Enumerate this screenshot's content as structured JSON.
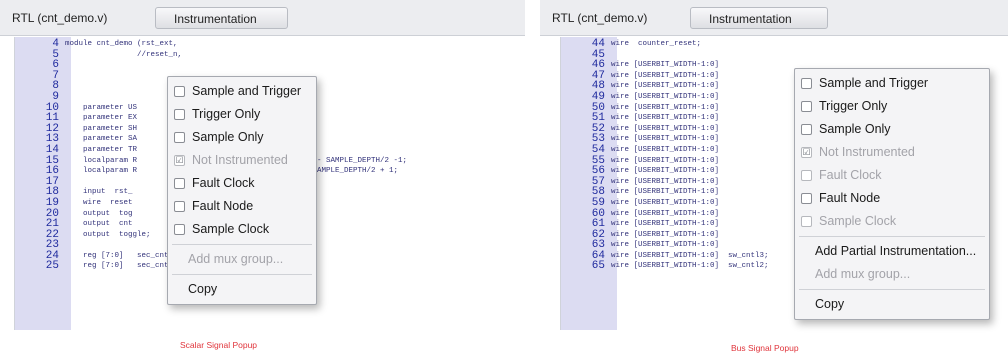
{
  "panels": {
    "scalar": {
      "file_tab": "RTL (cnt_demo.v)",
      "instr_tab": "Instrumentation",
      "lines": [
        {
          "num": "4",
          "code": "module cnt_demo (rst_ext,"
        },
        {
          "num": "5",
          "code": "                //reset_n,"
        },
        {
          "num": "6",
          "code": "                "
        },
        {
          "num": "7",
          "code": "                "
        },
        {
          "num": "8",
          "code": "                "
        },
        {
          "num": "9",
          "code": "                "
        },
        {
          "num": "10",
          "code": "    parameter US"
        },
        {
          "num": "11",
          "code": "    parameter EX"
        },
        {
          "num": "12",
          "code": "    parameter SH"
        },
        {
          "num": "13",
          "code": "    parameter SA"
        },
        {
          "num": "14",
          "code": "    parameter TR"
        },
        {
          "num": "15",
          "code": "    localparam R                              _POSITION - SAMPLE_DEPTH/2 -1;"
        },
        {
          "num": "16",
          "code": "    localparam R                             OSITION - SAMPLE_DEPTH/2 + 1;"
        },
        {
          "num": "17",
          "code": ""
        },
        {
          "num": "18",
          "code": "    input  rst_"
        },
        {
          "num": "19",
          "code": "    wire  reset"
        },
        {
          "num": "20",
          "code": "    output  tog"
        },
        {
          "num": "21",
          "code": "    output  cnt"
        },
        {
          "num": "22",
          "code": "    output  toggle;"
        },
        {
          "num": "23",
          "code": ""
        },
        {
          "num": "24",
          "code": "    reg [7:0]   sec_cnt_int;"
        },
        {
          "num": "25",
          "code": "    reg [7:0]   sec_cnt;"
        }
      ],
      "menu": {
        "items": [
          {
            "label": "Sample and Trigger",
            "check": "",
            "disabled": false
          },
          {
            "label": "Trigger Only",
            "check": "",
            "disabled": false
          },
          {
            "label": "Sample Only",
            "check": "",
            "disabled": false
          },
          {
            "label": "Not Instrumented",
            "check": "☑",
            "disabled": true
          },
          {
            "label": "Fault Clock",
            "check": "",
            "disabled": false
          },
          {
            "label": "Fault Node",
            "check": "",
            "disabled": false
          },
          {
            "label": "Sample Clock",
            "check": "",
            "disabled": false
          }
        ],
        "add_mux_group": "Add mux group...",
        "copy": "Copy"
      },
      "caption": "Scalar Signal Popup"
    },
    "bus": {
      "file_tab": "RTL (cnt_demo.v)",
      "instr_tab": "Instrumentation",
      "lines": [
        {
          "num": "44",
          "code": "wire  counter_reset;"
        },
        {
          "num": "45",
          "code": ""
        },
        {
          "num": "46",
          "code": "wire [USERBIT_WIDTH-1:0] "
        },
        {
          "num": "47",
          "code": "wire [USERBIT_WIDTH-1:0] "
        },
        {
          "num": "48",
          "code": "wire [USERBIT_WIDTH-1:0] "
        },
        {
          "num": "49",
          "code": "wire [USERBIT_WIDTH-1:0] "
        },
        {
          "num": "50",
          "code": "wire [USERBIT_WIDTH-1:0] "
        },
        {
          "num": "51",
          "code": "wire [USERBIT_WIDTH-1:0] "
        },
        {
          "num": "52",
          "code": "wire [USERBIT_WIDTH-1:0] "
        },
        {
          "num": "53",
          "code": "wire [USERBIT_WIDTH-1:0] "
        },
        {
          "num": "54",
          "code": "wire [USERBIT_WIDTH-1:0] "
        },
        {
          "num": "55",
          "code": "wire [USERBIT_WIDTH-1:0] "
        },
        {
          "num": "56",
          "code": "wire [USERBIT_WIDTH-1:0] "
        },
        {
          "num": "57",
          "code": "wire [USERBIT_WIDTH-1:0] "
        },
        {
          "num": "58",
          "code": "wire [USERBIT_WIDTH-1:0] "
        },
        {
          "num": "59",
          "code": "wire [USERBIT_WIDTH-1:0] "
        },
        {
          "num": "60",
          "code": "wire [USERBIT_WIDTH-1:0] "
        },
        {
          "num": "61",
          "code": "wire [USERBIT_WIDTH-1:0] "
        },
        {
          "num": "62",
          "code": "wire [USERBIT_WIDTH-1:0] "
        },
        {
          "num": "63",
          "code": "wire [USERBIT_WIDTH-1:0] "
        },
        {
          "num": "64",
          "code": "wire [USERBIT_WIDTH-1:0]  sw_cntl3;"
        },
        {
          "num": "65",
          "code": "wire [USERBIT_WIDTH-1:0]  sw_cntl2;"
        }
      ],
      "menu": {
        "items": [
          {
            "label": "Sample and Trigger",
            "check": "",
            "disabled": false
          },
          {
            "label": "Trigger Only",
            "check": "",
            "disabled": false
          },
          {
            "label": "Sample Only",
            "check": "",
            "disabled": false
          },
          {
            "label": "Not Instrumented",
            "check": "☑",
            "disabled": true
          },
          {
            "label": "Fault Clock",
            "check": "",
            "disabled": true
          },
          {
            "label": "Fault Node",
            "check": "",
            "disabled": false
          },
          {
            "label": "Sample Clock",
            "check": "",
            "disabled": true
          }
        ],
        "add_partial": "Add Partial Instrumentation...",
        "add_mux_group": "Add mux group...",
        "copy": "Copy"
      },
      "caption": "Bus Signal Popup"
    }
  }
}
